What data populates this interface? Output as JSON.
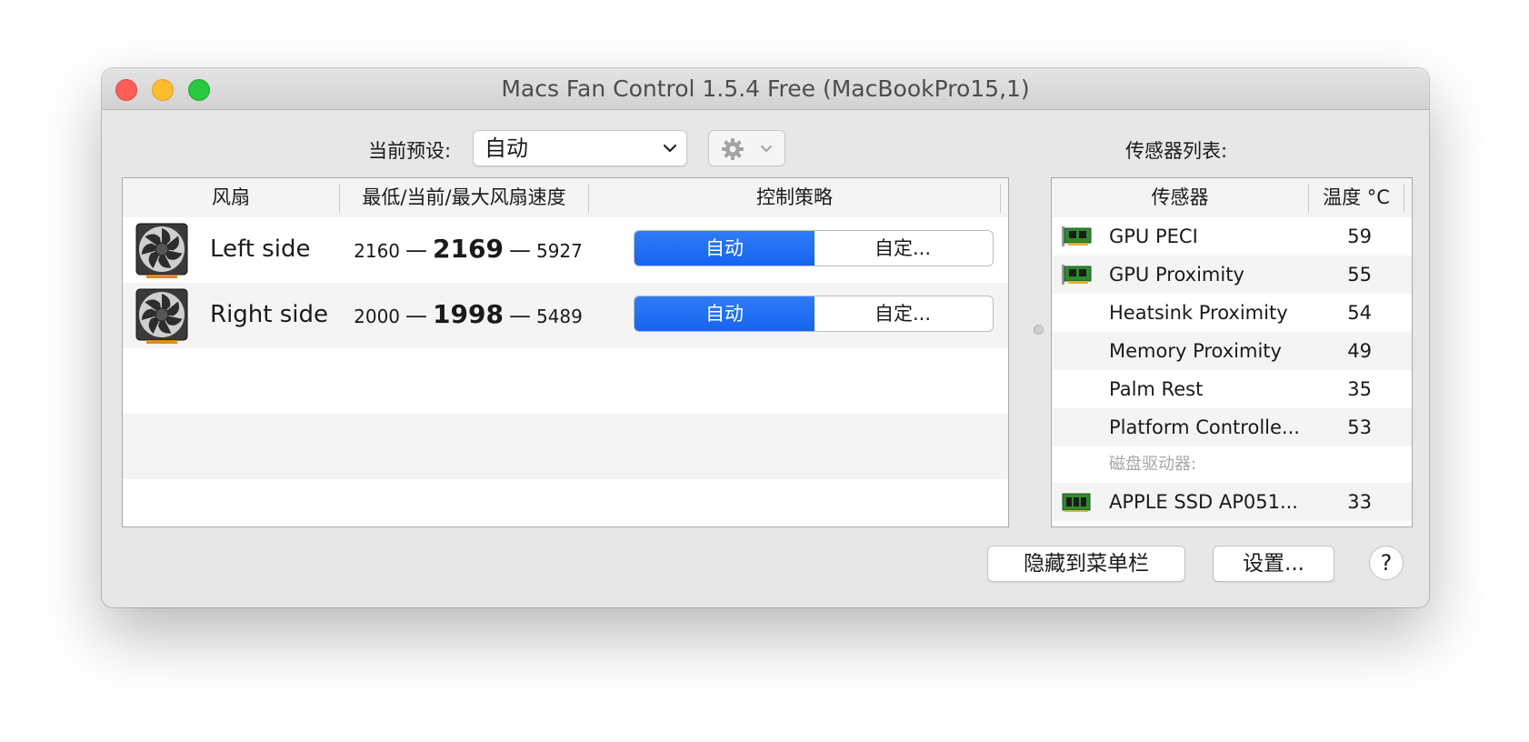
{
  "window": {
    "title": "Macs Fan Control 1.5.4 Free (MacBookPro15,1)"
  },
  "preset": {
    "label": "当前预设:",
    "value": "自动"
  },
  "fans_table": {
    "headers": [
      "风扇",
      "最低/当前/最大风扇速度",
      "控制策略"
    ],
    "rows": [
      {
        "name": "Left side",
        "min": "2160",
        "current": "2169",
        "max": "5927",
        "auto_label": "自动",
        "custom_label": "自定...",
        "mode": "auto"
      },
      {
        "name": "Right side",
        "min": "2000",
        "current": "1998",
        "max": "5489",
        "auto_label": "自动",
        "custom_label": "自定...",
        "mode": "auto"
      }
    ],
    "dash": "—"
  },
  "sensors": {
    "title": "传感器列表:",
    "headers": [
      "传感器",
      "温度 °C"
    ],
    "rows": [
      {
        "name": "GPU PECI",
        "temp": "59",
        "icon": "gpu-card-icon"
      },
      {
        "name": "GPU Proximity",
        "temp": "55",
        "icon": "gpu-card-icon"
      },
      {
        "name": "Heatsink Proximity",
        "temp": "54",
        "icon": ""
      },
      {
        "name": "Memory Proximity",
        "temp": "49",
        "icon": ""
      },
      {
        "name": "Palm Rest",
        "temp": "35",
        "icon": ""
      },
      {
        "name": "Platform Controlle...",
        "temp": "53",
        "icon": ""
      }
    ],
    "group_label": "磁盘驱动器:",
    "disk": {
      "name": "APPLE SSD AP051...",
      "temp": "33",
      "icon": "ssd-icon"
    }
  },
  "buttons": {
    "hide_to_menubar": "隐藏到菜单栏",
    "settings": "设置...",
    "help": "?"
  },
  "colors": {
    "accent": "#1a6cf2",
    "window_bg": "#e7e7e7",
    "close": "#fd5f57",
    "minimize": "#febc2e",
    "maximize": "#28c840"
  }
}
